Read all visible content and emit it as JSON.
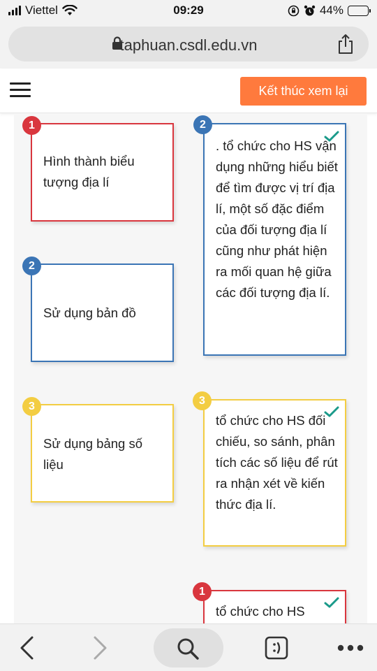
{
  "status_bar": {
    "carrier": "Viettel",
    "time": "09:29",
    "battery": "44%",
    "battery_level": 0.44,
    "icons": [
      "signal-icon",
      "wifi-icon",
      "orientation-lock-icon",
      "alarm-icon",
      "battery-icon"
    ]
  },
  "browser": {
    "url": "taphuan.csdl.edu.vn",
    "icons": [
      "lock-icon",
      "share-icon"
    ]
  },
  "header": {
    "menu_icon": "hamburger-menu-icon",
    "end_review_label": "Kết thúc xem lại"
  },
  "cards": {
    "left": [
      {
        "number": "1",
        "color": "red",
        "text": "Hình thành biểu tượng địa lí"
      },
      {
        "number": "2",
        "color": "blue",
        "text": "Sử dụng bản đồ"
      },
      {
        "number": "3",
        "color": "yellow",
        "text": "Sử dụng bảng số liệu"
      }
    ],
    "right": [
      {
        "number": "2",
        "color": "blue",
        "correct": true,
        "text": ". tổ chức cho HS vận dụng những hiểu biết để tìm được vị trí địa lí, một số đặc điểm của đối tượng địa lí cũng như phát hiện ra mối quan hệ giữa các đối tượng địa lí."
      },
      {
        "number": "3",
        "color": "yellow",
        "correct": true,
        "text": "tổ chức cho HS đối chiếu, so sánh, phân tích các số liệu để rút ra nhận xét về kiến thức địa lí."
      },
      {
        "number": "1",
        "color": "red",
        "correct": true,
        "text": "tổ chức cho HS"
      }
    ]
  },
  "colors": {
    "red": "#d9363e",
    "blue": "#3b75b5",
    "yellow": "#f3cd42",
    "accent": "#ff7a3d",
    "check": "#1a9a8a"
  },
  "toolbar": {
    "icons": [
      "back-icon",
      "forward-icon",
      "search-icon",
      "reader-mode-icon",
      "more-icon"
    ]
  }
}
